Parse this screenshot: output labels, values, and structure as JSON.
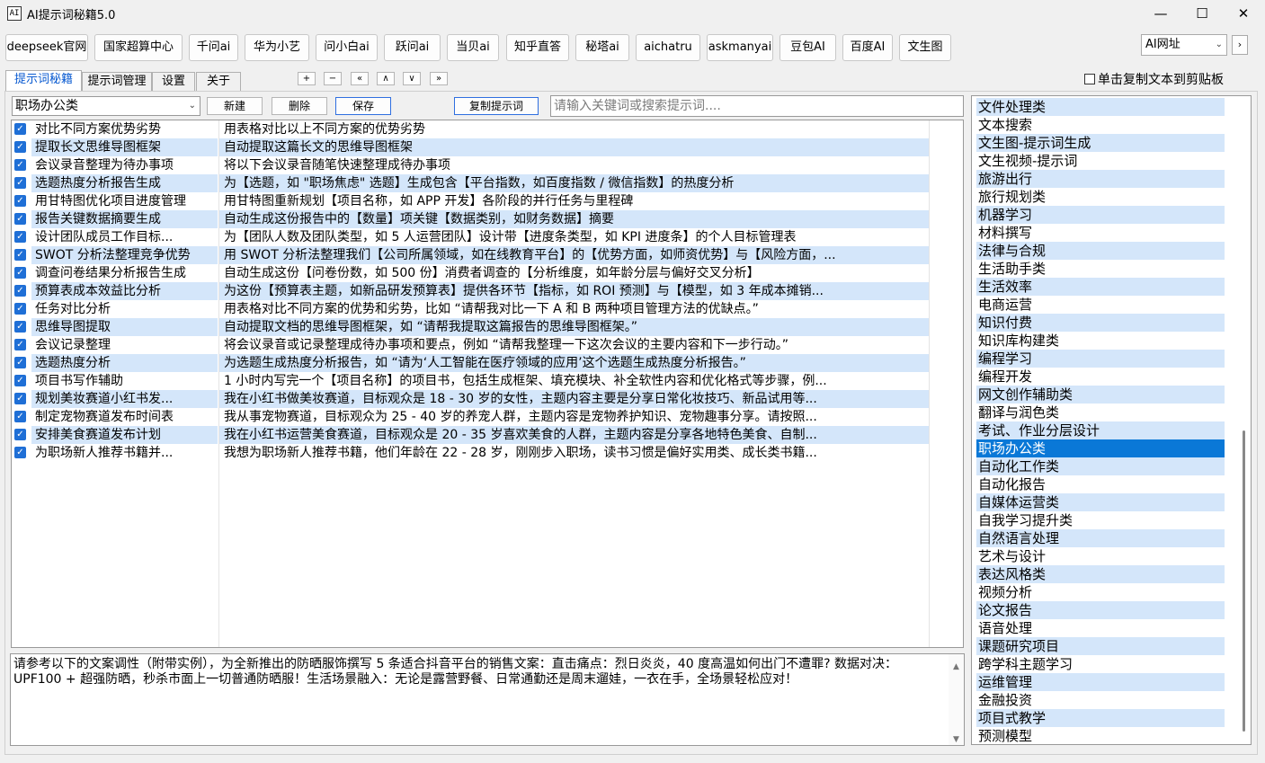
{
  "window": {
    "icon_text": "AI",
    "title": "AI提示词秘籍5.0",
    "minimize": "—",
    "maximize": "☐",
    "close": "✕"
  },
  "sites": [
    "deepseek官网",
    "国家超算中心",
    "千问ai",
    "华为小艺",
    "问小白ai",
    "跃问ai",
    "当贝ai",
    "知乎直答",
    "秘塔ai",
    "aichatru",
    "askmanyai",
    "豆包AI",
    "百度AI",
    "文生图"
  ],
  "site_select": {
    "value": "AI网址",
    "next": "›"
  },
  "tabs": [
    "提示词秘籍",
    "提示词管理",
    "设置",
    "关于"
  ],
  "small_buttons": [
    "+",
    "−",
    "«",
    "∧",
    "∨",
    "»"
  ],
  "copy_to_clipboard_label": "单击复制文本到剪贴板",
  "toolbar": {
    "category": "职场办公类",
    "new_label": "新建",
    "delete_label": "删除",
    "save_label": "保存",
    "copy_prompt_label": "复制提示词",
    "search_placeholder": "请输入关键词或搜索提示词...."
  },
  "prompts": [
    {
      "title": "对比不同方案优势劣势",
      "content": "用表格对比以上不同方案的优势劣势"
    },
    {
      "title": "提取长文思维导图框架",
      "content": "自动提取这篇长文的思维导图框架"
    },
    {
      "title": "会议录音整理为待办事项",
      "content": "将以下会议录音随笔快速整理成待办事项"
    },
    {
      "title": "选题热度分析报告生成",
      "content": "为【选题，如 \"职场焦虑\" 选题】生成包含【平台指数，如百度指数 / 微信指数】的热度分析"
    },
    {
      "title": "用甘特图优化项目进度管理",
      "content": "用甘特图重新规划【项目名称，如 APP 开发】各阶段的并行任务与里程碑"
    },
    {
      "title": "报告关键数据摘要生成",
      "content": "自动生成这份报告中的【数量】项关键【数据类别，如财务数据】摘要"
    },
    {
      "title": "设计团队成员工作目标...",
      "content": "为【团队人数及团队类型，如 5 人运营团队】设计带【进度条类型，如 KPI 进度条】的个人目标管理表"
    },
    {
      "title": "SWOT 分析法整理竞争优势",
      "content": "用 SWOT 分析法整理我们【公司所属领域，如在线教育平台】的【优势方面，如师资优势】与【风险方面，..."
    },
    {
      "title": "调查问卷结果分析报告生成",
      "content": "自动生成这份【问卷份数，如 500 份】消费者调查的【分析维度，如年龄分层与偏好交叉分析】"
    },
    {
      "title": "预算表成本效益比分析",
      "content": "为这份【预算表主题，如新品研发预算表】提供各环节【指标，如 ROI 预测】与【模型，如 3 年成本摊销..."
    },
    {
      "title": "任务对比分析",
      "content": "用表格对比不同方案的优势和劣势，比如 “请帮我对比一下 A 和 B 两种项目管理方法的优缺点。”"
    },
    {
      "title": "思维导图提取",
      "content": "自动提取文档的思维导图框架，如 “请帮我提取这篇报告的思维导图框架。”"
    },
    {
      "title": "会议记录整理",
      "content": "将会议录音或记录整理成待办事项和要点，例如 “请帮我整理一下这次会议的主要内容和下一步行动。”"
    },
    {
      "title": "选题热度分析",
      "content": "为选题生成热度分析报告，如 “请为‘人工智能在医疗领域的应用’这个选题生成热度分析报告。”"
    },
    {
      "title": "项目书写作辅助",
      "content": "1 小时内写完一个【项目名称】的项目书，包括生成框架、填充模块、补全软性内容和优化格式等步骤，例..."
    },
    {
      "title": "规划美妆赛道小红书发...",
      "content": "我在小红书做美妆赛道，目标观众是 18 - 30 岁的女性，主题内容主要是分享日常化妆技巧、新品试用等..."
    },
    {
      "title": "制定宠物赛道发布时间表",
      "content": "我从事宠物赛道，目标观众为 25 - 40 岁的养宠人群，主题内容是宠物养护知识、宠物趣事分享。请按照..."
    },
    {
      "title": "安排美食赛道发布计划",
      "content": "我在小红书运营美食赛道，目标观众是 20 - 35 岁喜欢美食的人群，主题内容是分享各地特色美食、自制..."
    },
    {
      "title": "为职场新人推荐书籍并...",
      "content": "我想为职场新人推荐书籍，他们年龄在 22 - 28 岁，刚刚步入职场，读书习惯是偏好实用类、成长类书籍..."
    }
  ],
  "textarea_content": "请参考以下的文案调性（附带实例），为全新推出的防晒服饰撰写 5 条适合抖音平台的销售文案：直击痛点：烈日炎炎，40 度高温如何出门不遭罪? 数据对决：UPF100 + 超强防晒，秒杀市面上一切普通防晒服！生活场景融入：无论是露营野餐、日常通勤还是周末遛娃，一衣在手，全场景轻松应对！",
  "scroll_up": "▲",
  "scroll_down": "▼",
  "categories": [
    "文件处理类",
    "文本搜索",
    "文生图-提示词生成",
    "文生视频-提示词",
    "旅游出行",
    "旅行规划类",
    "机器学习",
    "材料撰写",
    "法律与合规",
    "生活助手类",
    "生活效率",
    "电商运营",
    "知识付费",
    "知识库构建类",
    "编程学习",
    "编程开发",
    "网文创作辅助类",
    "翻译与润色类",
    "考试、作业分层设计",
    "职场办公类",
    "自动化工作类",
    "自动化报告",
    "自媒体运营类",
    "自我学习提升类",
    "自然语言处理",
    "艺术与设计",
    "表达风格类",
    "视频分析",
    "论文报告",
    "语音处理",
    "课题研究项目",
    "跨学科主题学习",
    "运维管理",
    "金融投资",
    "项目式教学",
    "预测模型"
  ],
  "selected_category_index": 19,
  "colors": {
    "accent": "#0a78d7",
    "row_alt": "#d4e6fa",
    "checkbox": "#1f6fd6"
  }
}
